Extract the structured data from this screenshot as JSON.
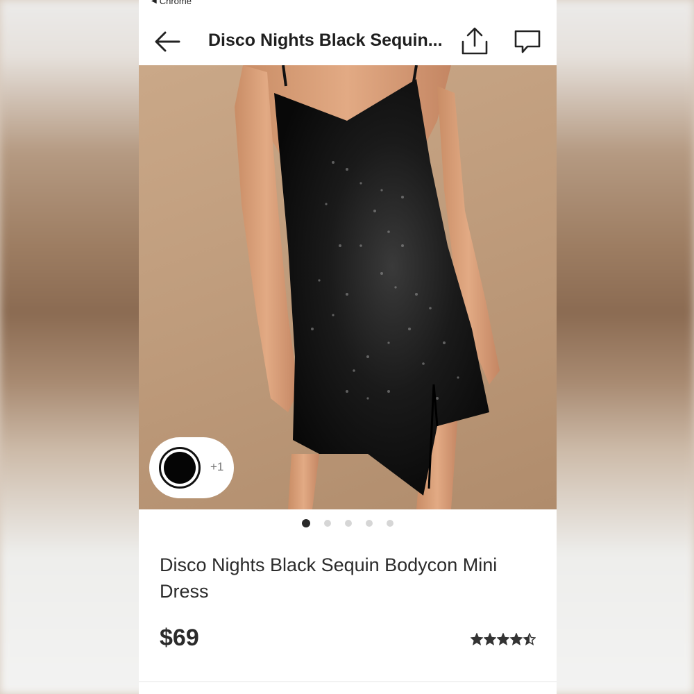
{
  "status_bar": {
    "app": "Chrome"
  },
  "header": {
    "title": "Disco Nights Black Sequin..."
  },
  "product": {
    "title": "Disco Nights Black Sequin Bodycon Mini Dress",
    "price": "$69",
    "rating": 4.5,
    "rating_max": 5,
    "selected_color": "#050505",
    "extra_colors_label": "+1"
  },
  "gallery": {
    "image_count": 5,
    "active_index": 0
  },
  "icons": [
    "back-arrow-icon",
    "share-icon",
    "comment-icon",
    "star-icon"
  ]
}
